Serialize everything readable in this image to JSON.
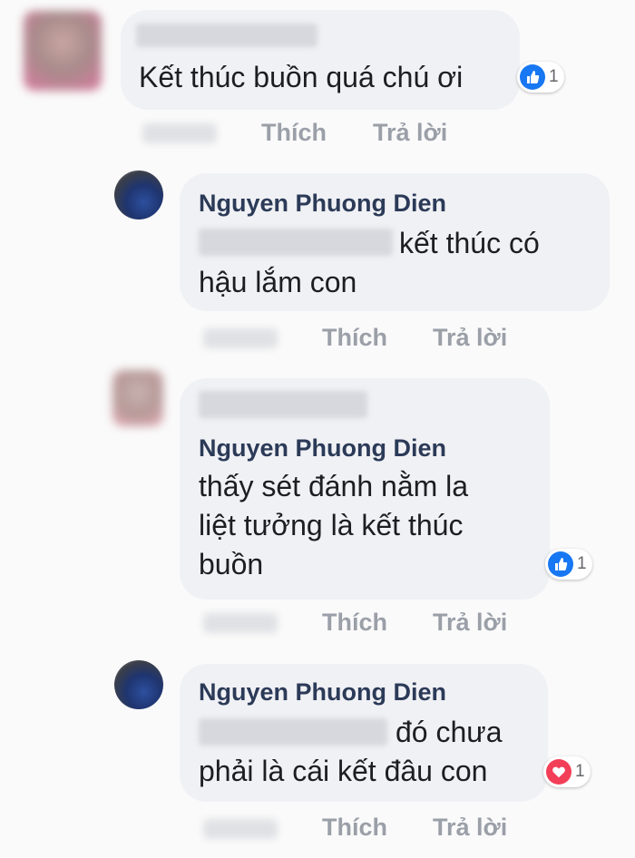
{
  "comments": [
    {
      "author_label": "",
      "lines": [
        "Kết thúc buồn quá chú ơi"
      ],
      "reaction": {
        "icon": "like-icon",
        "color": "#1877f2",
        "count": "1"
      },
      "like_label": "Thích",
      "reply_label": "Trả lời"
    },
    {
      "author": "Nguyen Phuong Dien",
      "line1_suffix": "kết thúc có",
      "line2": "hậu lắm con",
      "like_label": "Thích",
      "reply_label": "Trả lời"
    },
    {
      "mention": "Nguyen Phuong Dien",
      "lines": [
        "thấy sét đánh nằm la",
        "liệt tưởng là kết thúc",
        "buồn"
      ],
      "reaction": {
        "icon": "like-icon",
        "color": "#1877f2",
        "count": "1"
      },
      "like_label": "Thích",
      "reply_label": "Trả lời"
    },
    {
      "author": "Nguyen Phuong Dien",
      "line1_suffix": "đó chưa",
      "line2": "phải là cái kết đâu con",
      "reaction": {
        "icon": "love-icon",
        "color": "#f33e58",
        "count": "1"
      },
      "like_label": "Thích",
      "reply_label": "Trả lời"
    }
  ]
}
